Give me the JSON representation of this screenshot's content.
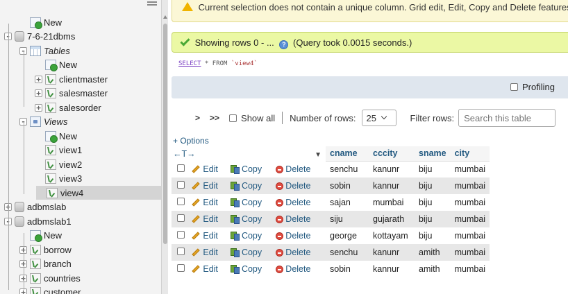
{
  "nav": {
    "items": [
      {
        "label": "New",
        "icon": "new-icon",
        "level": 1,
        "expander": "",
        "italic": false,
        "selected": false
      },
      {
        "label": "7-6-21dbms",
        "icon": "database-icon",
        "level": 0,
        "expander": "-",
        "italic": false,
        "selected": false
      },
      {
        "label": "Tables",
        "icon": "tables-icon",
        "level": 1,
        "expander": "-",
        "italic": true,
        "selected": false
      },
      {
        "label": "New",
        "icon": "new-icon",
        "level": 2,
        "expander": "",
        "italic": false,
        "selected": false
      },
      {
        "label": "clientmaster",
        "icon": "table-icon",
        "level": 2,
        "expander": "+",
        "italic": false,
        "selected": false
      },
      {
        "label": "salesmaster",
        "icon": "table-icon",
        "level": 2,
        "expander": "+",
        "italic": false,
        "selected": false
      },
      {
        "label": "salesorder",
        "icon": "table-icon",
        "level": 2,
        "expander": "+",
        "italic": false,
        "selected": false
      },
      {
        "label": "Views",
        "icon": "views-icon",
        "level": 1,
        "expander": "-",
        "italic": true,
        "selected": false
      },
      {
        "label": "New",
        "icon": "new-icon",
        "level": 2,
        "expander": "",
        "italic": false,
        "selected": false
      },
      {
        "label": "view1",
        "icon": "view-icon",
        "level": 2,
        "expander": "",
        "italic": false,
        "selected": false
      },
      {
        "label": "view2",
        "icon": "view-icon",
        "level": 2,
        "expander": "",
        "italic": false,
        "selected": false
      },
      {
        "label": "view3",
        "icon": "view-icon",
        "level": 2,
        "expander": "",
        "italic": false,
        "selected": false
      },
      {
        "label": "view4",
        "icon": "view-icon",
        "level": 2,
        "expander": "",
        "italic": false,
        "selected": true
      },
      {
        "label": "adbmslab",
        "icon": "database-icon",
        "level": 0,
        "expander": "+",
        "italic": false,
        "selected": false
      },
      {
        "label": "adbmslab1",
        "icon": "database-icon",
        "level": 0,
        "expander": "-",
        "italic": false,
        "selected": false
      },
      {
        "label": "New",
        "icon": "new-icon",
        "level": 1,
        "expander": "",
        "italic": false,
        "selected": false
      },
      {
        "label": "borrow",
        "icon": "table-icon",
        "level": 1,
        "expander": "+",
        "italic": false,
        "selected": false
      },
      {
        "label": "branch",
        "icon": "table-icon",
        "level": 1,
        "expander": "+",
        "italic": false,
        "selected": false
      },
      {
        "label": "countries",
        "icon": "table-icon",
        "level": 1,
        "expander": "+",
        "italic": false,
        "selected": false
      },
      {
        "label": "customer",
        "icon": "table-icon",
        "level": 1,
        "expander": "+",
        "italic": false,
        "selected": false
      }
    ]
  },
  "warning": {
    "text": "Current selection does not contain a unique column. Grid edit, Edit, Copy and Delete features may result in undesired behavior."
  },
  "success": {
    "text": "Showing rows 0 - ...",
    "query_time": "(Query took 0.0015 seconds.)"
  },
  "sql": {
    "keyword": "SELECT",
    "rest": " * FROM ",
    "table": "`view4`"
  },
  "profiling": {
    "label": "Profiling"
  },
  "navigation": {
    "next": ">",
    "last": ">>",
    "show_all": "Show all",
    "rows_label": "Number of rows:",
    "rows_value": "25",
    "filter_label": "Filter rows:",
    "filter_placeholder": "Search this table"
  },
  "options_link": "+ Options",
  "sort_arrows": "←T→",
  "table": {
    "columns": [
      "cname",
      "cccity",
      "sname",
      "city"
    ],
    "actions": {
      "edit": "Edit",
      "copy": "Copy",
      "delete": "Delete"
    },
    "rows": [
      [
        "senchu",
        "kanunr",
        "biju",
        "mumbai"
      ],
      [
        "sobin",
        "kannur",
        "biju",
        "mumbai"
      ],
      [
        "sajan",
        "mumbai",
        "biju",
        "mumbai"
      ],
      [
        "siju",
        "gujarath",
        "biju",
        "mumbai"
      ],
      [
        "george",
        "kottayam",
        "biju",
        "mumbai"
      ],
      [
        "senchu",
        "kanunr",
        "amith",
        "mumbai"
      ],
      [
        "sobin",
        "kannur",
        "amith",
        "mumbai"
      ]
    ]
  },
  "colors": {
    "link": "#235a81",
    "success_bg": "#ebf8a4",
    "warning_bg": "#fbf7d6",
    "nav_bg": "#f3f3f3",
    "row_alt": "#e7e7e7"
  }
}
